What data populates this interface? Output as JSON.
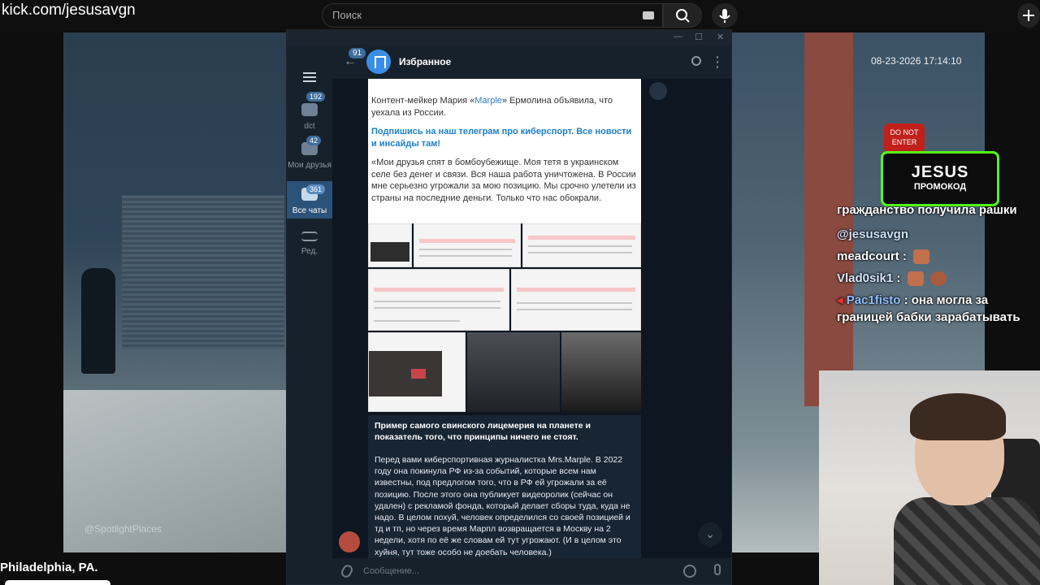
{
  "browser": {
    "url_text": "kick.com/jesusavgn",
    "search_placeholder": "Поиск"
  },
  "stream": {
    "timestamp": "08-23-2026 17:14:10",
    "stop_sign_line1": "DO NOT",
    "stop_sign_line2": "ENTER",
    "watermark": "@SpotlightPlaces",
    "location": "Philadelphia, PA.",
    "promo_title": "JESUS",
    "promo_subtitle": "ПРОМОКОД"
  },
  "chat": {
    "cut_line": "гражданство получила рашки",
    "mention": "@jesusavgn",
    "messages": [
      {
        "nick": "meadcourt",
        "text": ""
      },
      {
        "nick": "Vlad0sik1",
        "text": ""
      },
      {
        "nick": "Pac1fisto",
        "text": "она могла за границей бабки зарабатывать"
      }
    ]
  },
  "telegram": {
    "rail": {
      "items": [
        {
          "label": "dct",
          "badge": "192"
        },
        {
          "label": "Мои друзья",
          "badge": "42"
        },
        {
          "label": "Все чаты",
          "badge": "361"
        },
        {
          "label": "Ред.",
          "badge": ""
        }
      ]
    },
    "header": {
      "back_badge": "91",
      "title": "Избранное"
    },
    "post": {
      "p1_before": "Контент-мейкер Мария «",
      "p1_link": "Marple",
      "p1_after": "» Ермолина объявила, что уехала из России.",
      "p2": "Подпишись на наш телеграм про киберспорт. Все новости и инсайды там!",
      "p3": "«Мои друзья спят в бомбоубежище. Моя тетя в украинском селе без денег и связи. Вся наша работа уничтожена. В России мне серьезно угрожали за мою позицию. Мы срочно улетели из страны на последние деньги. Только что нас обокрали."
    },
    "message": {
      "bold": "Пример самого свинского лицемерия на планете и показатель того, что принципы ничего не стоят.",
      "body": "Перед вами киберспортивная журналистка Mrs.Marple. В 2022 году она покинула РФ из-за событий, которые всем нам известны, под предлогом того, что в РФ ей угрожали за её позицию. После этого она публикует видеоролик (сейчас он удален) с рекламой фонда, который делает сборы туда, куда не надо. В целом похуй, человек определился со своей позицией и тд и тп, но через время Марпл возвращается в Москву на 2 недели, хотя по её же словам ей тут угрожают. (И в целом это хуйня, тут тоже особо не доебать человека.)"
    },
    "input_placeholder": "Сообщение..."
  }
}
